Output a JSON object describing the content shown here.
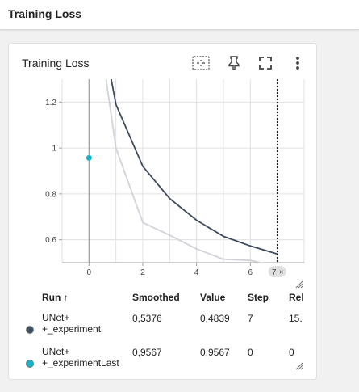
{
  "header": {
    "title": "Training Loss"
  },
  "card": {
    "title": "Training Loss",
    "tools": [
      "fit-domain-icon",
      "pin-icon",
      "fullscreen-icon",
      "more-vert-icon"
    ]
  },
  "colors": {
    "smoothed_line": "#3d4a5e",
    "raw_line": "#d2d2da",
    "experiment_last": "#12b5cb",
    "experiment": "#425066",
    "grid": "#e0e0e0"
  },
  "chart_data": {
    "type": "line",
    "title": "Training Loss",
    "xlabel": "",
    "ylabel": "",
    "xlim": [
      -1,
      8
    ],
    "ylim": [
      0.5,
      1.3
    ],
    "x_ticks": [
      "0",
      "2",
      "4",
      "6"
    ],
    "y_ticks": [
      "0.6",
      "0.8",
      "1",
      "1.2"
    ],
    "hover_step_label": "7",
    "grid": true,
    "series": [
      {
        "name": "UNet+ +_experiment (raw)",
        "x": [
          0,
          1,
          2,
          3,
          4,
          5,
          6,
          7
        ],
        "y": [
          1.82,
          1.0,
          0.675,
          0.62,
          0.56,
          0.515,
          0.51,
          0.484
        ]
      },
      {
        "name": "UNet+ +_experiment (smoothed)",
        "x": [
          0,
          1,
          2,
          3,
          4,
          5,
          6,
          7
        ],
        "y": [
          1.82,
          1.19,
          0.92,
          0.78,
          0.685,
          0.615,
          0.573,
          0.538
        ]
      },
      {
        "name": "UNet+ +_experimentLast",
        "x": [
          0
        ],
        "y": [
          0.9567
        ]
      }
    ]
  },
  "table": {
    "headers": {
      "run": "Run ↑",
      "smoothed": "Smoothed",
      "value": "Value",
      "step": "Step",
      "relative": "Rel"
    },
    "rows": [
      {
        "name": "UNet+\n+_experiment",
        "smoothed": "0,5376",
        "value": "0,4839",
        "step": "7",
        "relative": "15. "
      },
      {
        "name": "UNet+\n+_experimentLast",
        "smoothed": "0,9567",
        "value": "0,9567",
        "step": "0",
        "relative": "0"
      }
    ]
  }
}
